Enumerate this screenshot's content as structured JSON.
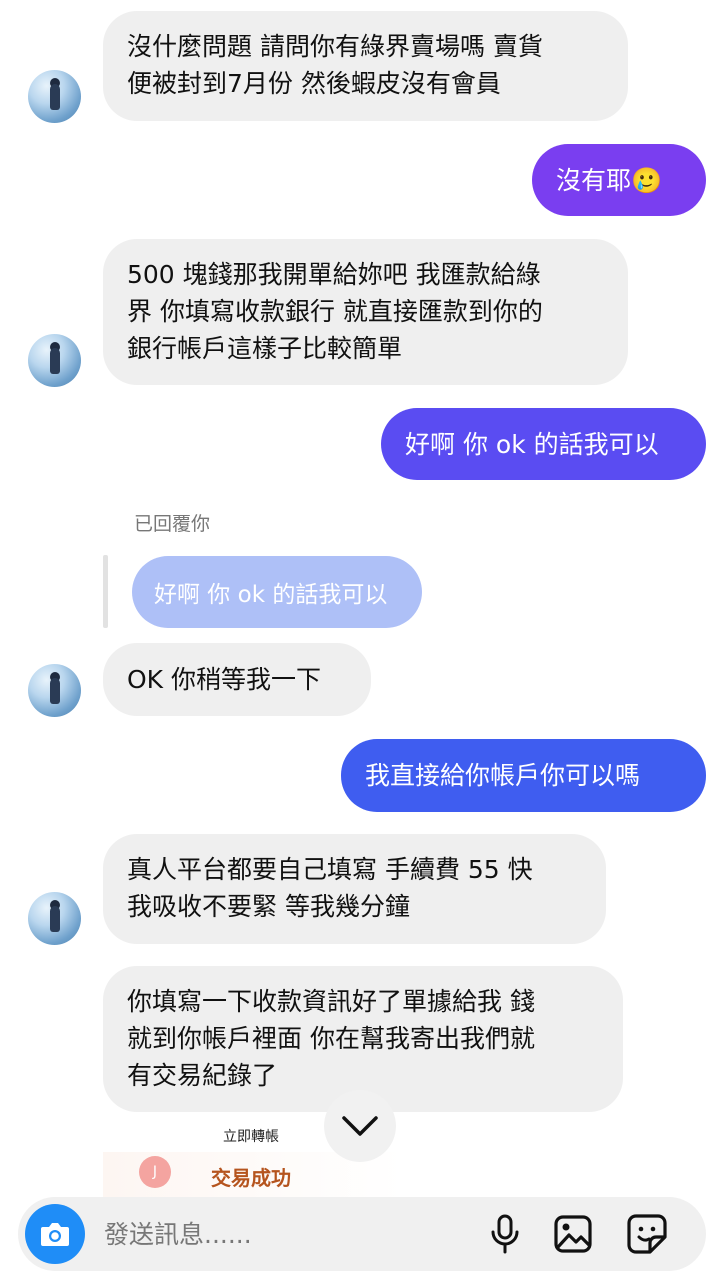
{
  "messages": {
    "m1": "沒什麼問題 請問你有綠界賣場嗎 賣貨\n便被封到7月份 然後蝦皮沒有會員",
    "m2": "沒有耶🥲",
    "m3": "500 塊錢那我開單給妳吧 我匯款給綠\n界 你填寫收款銀行 就直接匯款到你的\n銀行帳戶這樣子比較簡單",
    "m4": "好啊 你 ok 的話我可以",
    "reply_label": "已回覆你",
    "reply_quote": "好啊 你 ok 的話我可以",
    "m5": "OK 你稍等我一下",
    "m6": "我直接給你帳戶你可以嗎",
    "m7": "真人平台都要自己填寫 手續費 55 快\n我吸收不要緊 等我幾分鐘",
    "m8": "你填寫一下收款資訊好了單據給我 錢\n就到你帳戶裡面 你在幫我寄出我們就\n有交易紀錄了"
  },
  "attachment": {
    "title": "立即轉帳",
    "status": "交易成功"
  },
  "composer": {
    "placeholder": "發送訊息......"
  },
  "colors": {
    "incoming_bubble": "#efefef",
    "outgoing_purple": "#7a3ef0",
    "outgoing_blue": "#3f5df0",
    "reply_quote": "#aec0f7",
    "camera": "#1f8df7"
  }
}
